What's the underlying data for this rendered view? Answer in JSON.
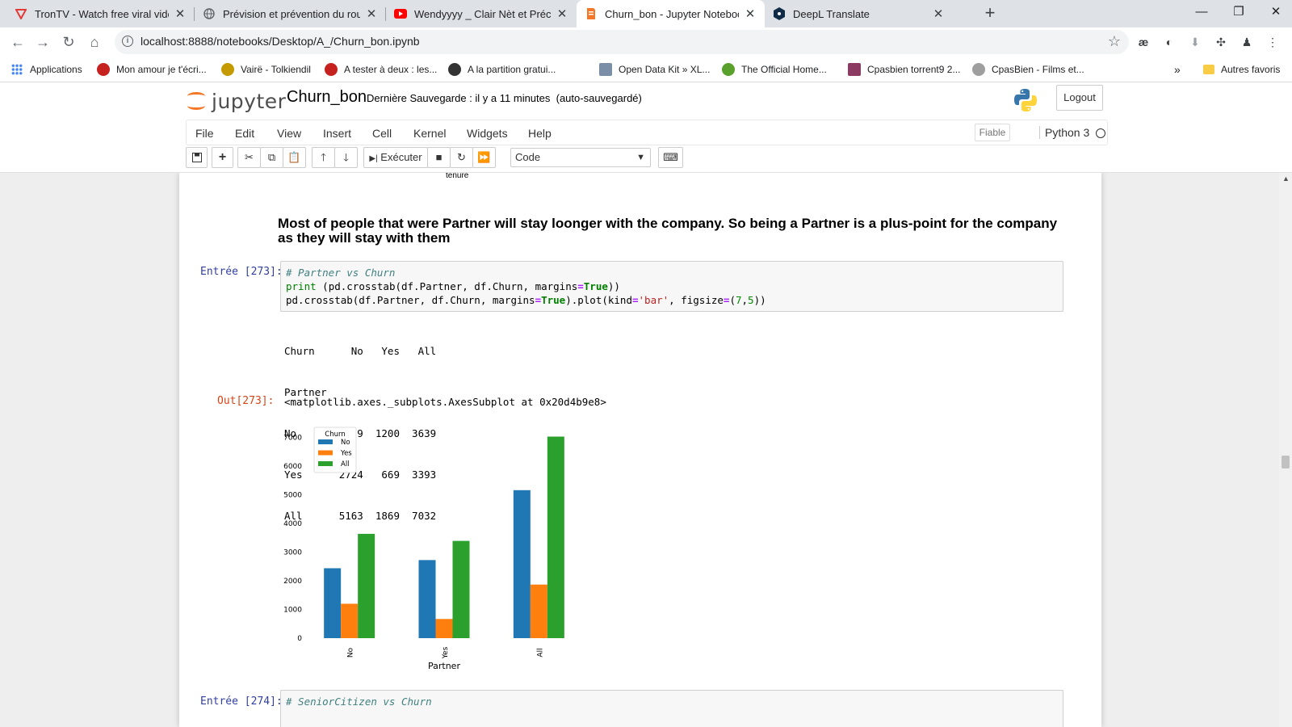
{
  "browser": {
    "tabs": [
      {
        "title": "TronTV - Watch free viral videos",
        "icon": "trontv-icon"
      },
      {
        "title": "Prévision et prévention du roulem",
        "icon": "globe-icon"
      },
      {
        "title": "Wendyyyy _ Clair Nèt et Précis ( c",
        "icon": "youtube-icon"
      },
      {
        "title": "Churn_bon - Jupyter Notebook",
        "icon": "jupyter-icon",
        "active": true
      },
      {
        "title": "DeepL Translate",
        "icon": "deepl-icon"
      }
    ],
    "url": "localhost:8888/notebooks/Desktop/A_/Churn_bon.ipynb",
    "bookmarks": [
      {
        "label": "Applications",
        "color": "#4285f4"
      },
      {
        "label": "Mon amour je t'écri...",
        "color": "#c5221f"
      },
      {
        "label": "Vairë - Tolkiendil",
        "color": "#c49a00"
      },
      {
        "label": "A tester à deux : les...",
        "color": "#c5221f"
      },
      {
        "label": "A la partition gratui...",
        "color": "#333333"
      },
      {
        "label": "Open Data Kit » XL...",
        "color": "#7a8ea7"
      },
      {
        "label": "The Official Home...",
        "color": "#5aa02c"
      },
      {
        "label": "Cpasbien torrent9 2...",
        "color": "#8b3a62"
      },
      {
        "label": "CpasBien - Films et...",
        "color": "#9e9e9e"
      }
    ],
    "more_bookmarks": "»",
    "other_favorites": "Autres favoris"
  },
  "jupyter": {
    "logo_text": "jupyter",
    "notebook_name": "Churn_bon",
    "save_status": "Dernière Sauvegarde : il y a 11 minutes",
    "autosave": "(auto-sauvegardé)",
    "logout": "Logout",
    "menus": [
      "File",
      "Edit",
      "View",
      "Insert",
      "Cell",
      "Kernel",
      "Widgets",
      "Help"
    ],
    "trusted": "Fiable",
    "kernel": "Python 3",
    "run_label": "Exécuter",
    "cell_type": "Code"
  },
  "notebook": {
    "prev_xlabel": "tenure",
    "markdown": "Most of people that were Partner will stay loonger with the company. So being a Partner is a plus-point for the company as they will stay with them",
    "cell1": {
      "in_prompt": "Entrée [273]:",
      "line1": "# Partner vs Churn",
      "line2_a": "print",
      "line2_b": " (pd.crosstab(df.Partner, df.Churn, margins",
      "line2_c": "=",
      "line2_d": "True",
      "line2_e": "))",
      "line3_a": "pd.crosstab(df.Partner, df.Churn, margins",
      "line3_b": "=",
      "line3_c": "True",
      "line3_d": ").plot(kind",
      "line3_e": "=",
      "line3_f": "'bar'",
      "line3_g": ", figsize",
      "line3_h": "=",
      "line3_i": "(",
      "line3_j": "7",
      "line3_k": ",",
      "line3_l": "5",
      "line3_m": "))",
      "stdout": [
        "Churn      No   Yes   All",
        "Partner",
        "No       2439  1200  3639",
        "Yes      2724   669  3393",
        "All      5163  1869  7032"
      ],
      "out_prompt": "Out[273]:",
      "out_repr": "<matplotlib.axes._subplots.AxesSubplot at 0x20d4b9e8>"
    },
    "cell2": {
      "in_prompt": "Entrée [274]:",
      "line1": "# SeniorCitizen vs Churn"
    }
  },
  "chart_data": {
    "type": "bar",
    "categories": [
      "No",
      "Yes",
      "All"
    ],
    "series": [
      {
        "name": "No",
        "color": "#1f77b4",
        "values": [
          2439,
          2724,
          5163
        ]
      },
      {
        "name": "Yes",
        "color": "#ff7f0e",
        "values": [
          1200,
          669,
          1869
        ]
      },
      {
        "name": "All",
        "color": "#2ca02c",
        "values": [
          3639,
          3393,
          7032
        ]
      }
    ],
    "legend_title": "Churn",
    "legend_position": "top-left",
    "xlabel": "Partner",
    "ylabel": "",
    "yticks": [
      0,
      1000,
      2000,
      3000,
      4000,
      5000,
      6000,
      7000
    ],
    "ylim": [
      0,
      7384
    ],
    "grid": false
  }
}
